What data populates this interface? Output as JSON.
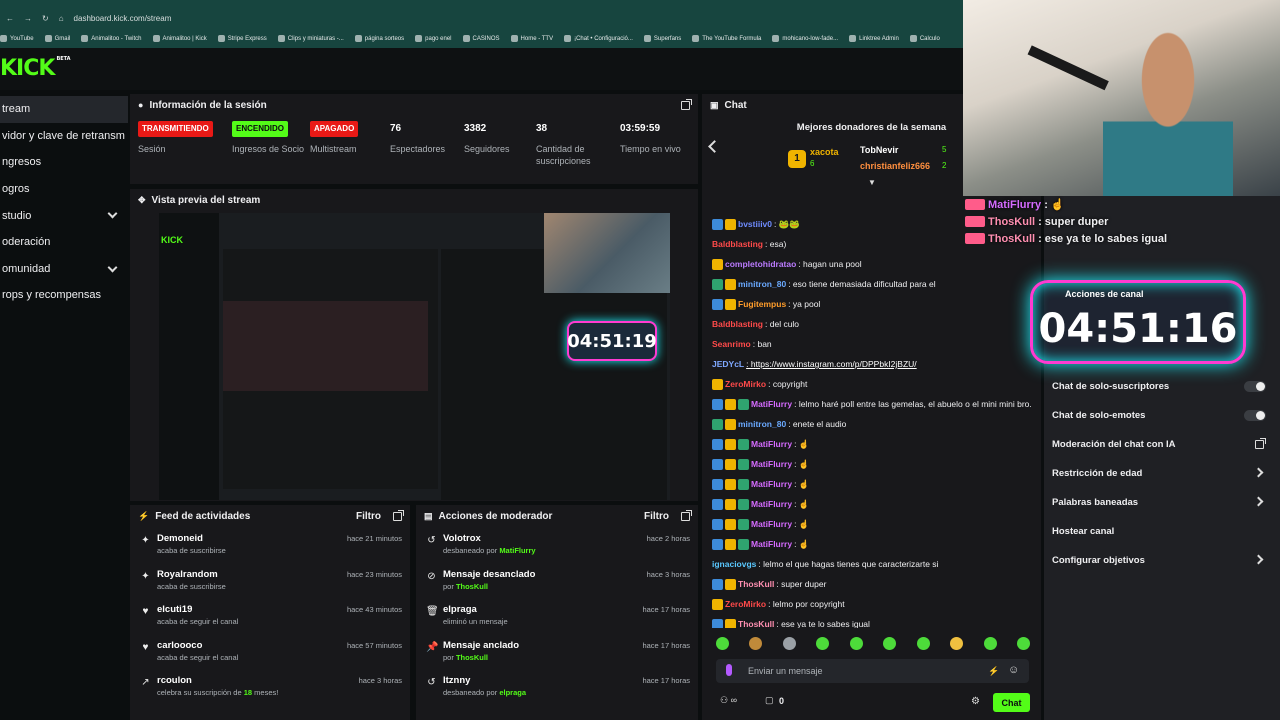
{
  "browser": {
    "url": "dashboard.kick.com/stream",
    "bookmarks": [
      "YouTube",
      "Gmail",
      "Animalitoo - Twitch",
      "Animalitoo | Kick",
      "Stripe Express",
      "Clips y miniaturas -...",
      "página sorteos",
      "pago enel",
      "CASINOS",
      "Home - TTV",
      "¡Chat • Configuració...",
      "Superfans",
      "The YouTube Formula",
      "mohicano-low-fade...",
      "Linktree Admin",
      "Calculo"
    ]
  },
  "logo": {
    "text": "KICK",
    "tag": "BETA"
  },
  "sidebar": {
    "items": [
      {
        "label": "tream",
        "active": true
      },
      {
        "label": "vidor y clave de retransm"
      },
      {
        "label": "ngresos"
      },
      {
        "label": "ogros"
      },
      {
        "label": "studio",
        "chevron": true
      },
      {
        "label": "oderación"
      },
      {
        "label": "omunidad",
        "chevron": true
      },
      {
        "label": "rops y recompensas"
      }
    ]
  },
  "session": {
    "title": "Información de la sesión",
    "stats": [
      {
        "value": "TRANSMITIENDO",
        "label": "Sesión",
        "badge": "red"
      },
      {
        "value": "ENCENDIDO",
        "label": "Ingresos de Socio",
        "badge": "green"
      },
      {
        "value": "APAGADO",
        "label": "Multistream",
        "badge": "red"
      },
      {
        "value": "76",
        "label": "Espectadores"
      },
      {
        "value": "3382",
        "label": "Seguidores"
      },
      {
        "value": "38",
        "label": "Cantidad de suscripciones"
      },
      {
        "value": "03:59:59",
        "label": "Tiempo en vivo"
      }
    ]
  },
  "preview": {
    "title": "Vista previa del stream",
    "timer": "04:51:19",
    "logo": "KICK"
  },
  "activity": {
    "title": "Feed de actividades",
    "filter": "Filtro",
    "items": [
      {
        "icon": "✦",
        "name": "Demoneid",
        "sub": "acaba de suscribirse",
        "time": "hace 21 minutos"
      },
      {
        "icon": "✦",
        "name": "Royalrandom",
        "sub": "acaba de suscribirse",
        "time": "hace 23 minutos"
      },
      {
        "icon": "♥",
        "name": "elcuti19",
        "sub": "acaba de seguir el canal",
        "time": "hace 43 minutos"
      },
      {
        "icon": "♥",
        "name": "carloooco",
        "sub": "acaba de seguir el canal",
        "time": "hace 57 minutos"
      },
      {
        "icon": "↗",
        "name": "rcoulon",
        "sub_pre": "celebra su suscripción de ",
        "sub_hl": "18",
        "sub_post": " meses!",
        "time": "hace 3 horas"
      }
    ]
  },
  "modactions": {
    "title": "Acciones de moderador",
    "filter": "Filtro",
    "items": [
      {
        "icon": "↺",
        "name": "Volotrox",
        "sub": "desbaneado por ",
        "by": "MatiFlurry",
        "time": "hace 2 horas"
      },
      {
        "icon": "⊘",
        "name": "Mensaje desanclado",
        "sub": "por ",
        "by": "ThosKull",
        "time": "hace 3 horas"
      },
      {
        "icon": "🗑",
        "name": "elpraga",
        "sub": "eliminó un mensaje",
        "by": "",
        "time": "hace 17 horas"
      },
      {
        "icon": "📌",
        "name": "Mensaje anclado",
        "sub": "por ",
        "by": "ThosKull",
        "time": "hace 17 horas"
      },
      {
        "icon": "↺",
        "name": "Itznny",
        "sub": "desbaneado por ",
        "by": "elpraga",
        "time": "hace 17 horas"
      }
    ]
  },
  "chat": {
    "title": "Chat",
    "donors_title": "Mejores donadores de la semana",
    "donors": [
      {
        "rank": "1",
        "name": "xacota",
        "amount": "6",
        "color": "#f0b400"
      },
      {
        "name": "TobNevir",
        "amount": "5",
        "color": "#ffffff"
      },
      {
        "name": "christianfeliz666",
        "amount": "2",
        "color": "#ff8f3f"
      }
    ],
    "messages": [
      {
        "user": "",
        "text": "",
        "ucolor": "#7fc4ff"
      },
      {
        "user": "bvstiiiv0",
        "text": ": 🐸🐸",
        "ucolor": "#6f8cff",
        "badges": [
          "#3d8bd9",
          "#f0b400"
        ]
      },
      {
        "user": "Baldblasting",
        "text": ": esa)",
        "ucolor": "#ff4a4a"
      },
      {
        "user": "completohidratao",
        "text": ": hagan una pool",
        "ucolor": "#bb7bff",
        "badges": [
          "#f0b400"
        ]
      },
      {
        "user": "minitron_80",
        "text": ": eso tiene demasiada dificultad para el",
        "ucolor": "#6aa9ff",
        "badges": [
          "#2fa36f",
          "#f0b400"
        ]
      },
      {
        "user": "Fugitempus",
        "text": ": ya pool",
        "ucolor": "#ff9d2b",
        "badges": [
          "#3d8bd9",
          "#f0b400"
        ]
      },
      {
        "user": "Baldblasting",
        "text": ": del culo",
        "ucolor": "#ff4a4a"
      },
      {
        "user": "Seanrimo",
        "text": ": ban",
        "ucolor": "#ff4a4a"
      },
      {
        "user": "JEDYcL",
        "text": ": https://www.instagram.com/p/DPPbkI2jBZU/",
        "ucolor": "#7fa8ff",
        "link": true
      },
      {
        "user": "ZeroMirko",
        "text": ": copyright",
        "ucolor": "#ff4a4a",
        "badges": [
          "#f0b400"
        ]
      },
      {
        "user": "MatiFlurry",
        "text": ": lelmo haré poll entre las gemelas, el abuelo o el mini mini bro.",
        "ucolor": "#d56bff",
        "badges": [
          "#3d8bd9",
          "#f0b400",
          "#2fa36f"
        ]
      },
      {
        "user": "minitron_80",
        "text": ": enete el audio",
        "ucolor": "#6aa9ff",
        "badges": [
          "#2fa36f",
          "#f0b400"
        ]
      },
      {
        "user": "MatiFlurry",
        "text": ": ☝",
        "ucolor": "#d56bff",
        "badges": [
          "#3d8bd9",
          "#f0b400",
          "#2fa36f"
        ]
      },
      {
        "user": "MatiFlurry",
        "text": ": ☝",
        "ucolor": "#d56bff",
        "badges": [
          "#3d8bd9",
          "#f0b400",
          "#2fa36f"
        ]
      },
      {
        "user": "MatiFlurry",
        "text": ": ☝",
        "ucolor": "#d56bff",
        "badges": [
          "#3d8bd9",
          "#f0b400",
          "#2fa36f"
        ]
      },
      {
        "user": "MatiFlurry",
        "text": ": ☝",
        "ucolor": "#d56bff",
        "badges": [
          "#3d8bd9",
          "#f0b400",
          "#2fa36f"
        ]
      },
      {
        "user": "MatiFlurry",
        "text": ": ☝",
        "ucolor": "#d56bff",
        "badges": [
          "#3d8bd9",
          "#f0b400",
          "#2fa36f"
        ]
      },
      {
        "user": "MatiFlurry",
        "text": ": ☝",
        "ucolor": "#d56bff",
        "badges": [
          "#3d8bd9",
          "#f0b400",
          "#2fa36f"
        ]
      },
      {
        "user": "ignaciovgs",
        "text": ": lelmo el que hagas tienes que caracterizarte si",
        "ucolor": "#5ac8ff"
      },
      {
        "user": "ThosKull",
        "text": ": super duper",
        "ucolor": "#ff8fb1",
        "badges": [
          "#3d8bd9",
          "#f0b400"
        ]
      },
      {
        "user": "ZeroMirko",
        "text": ": lelmo por copyright",
        "ucolor": "#ff4a4a",
        "badges": [
          "#f0b400"
        ]
      },
      {
        "user": "ThosKull",
        "text": ": ese ya te lo sabes igual",
        "ucolor": "#ff8fb1",
        "badges": [
          "#3d8bd9",
          "#f0b400"
        ]
      }
    ],
    "input_placeholder": "Enviar un mensaje",
    "viewer_count": "0",
    "send_label": "Chat"
  },
  "channel_actions": {
    "title": "Acciones de canal",
    "timer": "04:51:16",
    "options": [
      {
        "label": "Chat de solo-suscriptores",
        "toggle": true
      },
      {
        "label": "Chat de solo-emotes",
        "toggle": true
      },
      {
        "label": "Moderación del chat con IA",
        "ext": true
      },
      {
        "label": "Restricción de edad",
        "chevron": true
      },
      {
        "label": "Palabras baneadas",
        "chevron": true
      },
      {
        "label": "Hostear canal"
      },
      {
        "label": "Configurar objetivos",
        "chevron": true
      }
    ]
  },
  "overlay_chat": [
    {
      "user": "MatiFlurry",
      "text": ": ☝",
      "ucolor": "#d56bff"
    },
    {
      "user": "ThosKull",
      "text": ": super duper",
      "ucolor": "#ff8fb1"
    },
    {
      "user": "ThosKull",
      "text": ": ese ya te lo sabes igual",
      "ucolor": "#ff8fb1"
    }
  ],
  "colors": {
    "brand": "#53fc18",
    "panel": "#18181b",
    "live": "#e91916",
    "timer_border": "#ff3bd1",
    "timer_glow": "#1ef3ff"
  }
}
